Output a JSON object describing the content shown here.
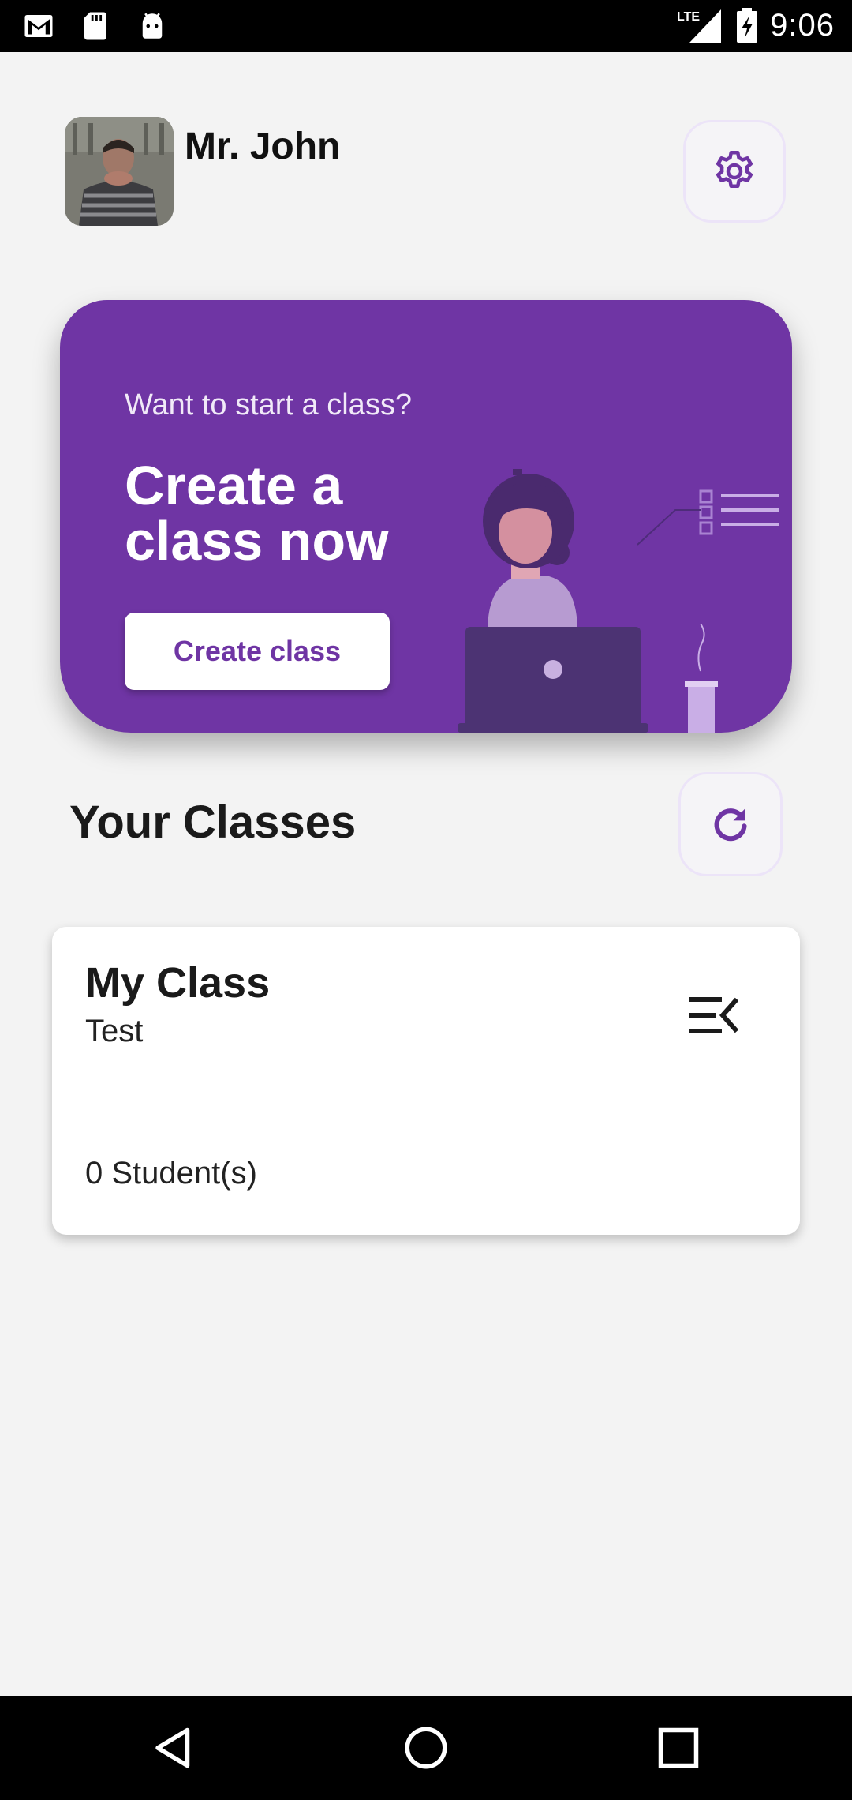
{
  "status_bar": {
    "time": "9:06",
    "network": "LTE",
    "icons": [
      "gmail-icon",
      "sd-card-icon",
      "android-icon",
      "signal-icon",
      "battery-charging-icon"
    ]
  },
  "header": {
    "user_name": "Mr. John",
    "avatar": "user-photo",
    "settings_icon": "gear-icon"
  },
  "hero": {
    "subtitle": "Want to start a class?",
    "title": "Create a class now",
    "button_label": "Create class",
    "background_color": "#6f35a4",
    "illustration": "woman-at-laptop-illustration"
  },
  "classes_section": {
    "title": "Your Classes",
    "refresh_icon": "refresh-icon",
    "items": [
      {
        "name": "My Class",
        "subject": "Test",
        "students": "0 Student(s)",
        "menu_icon": "menu-collapse-icon"
      }
    ]
  },
  "nav_bar": {
    "icons": [
      "back-icon",
      "home-icon",
      "recents-icon"
    ]
  },
  "colors": {
    "accent": "#6f35a4",
    "background": "#f3f3f3"
  }
}
